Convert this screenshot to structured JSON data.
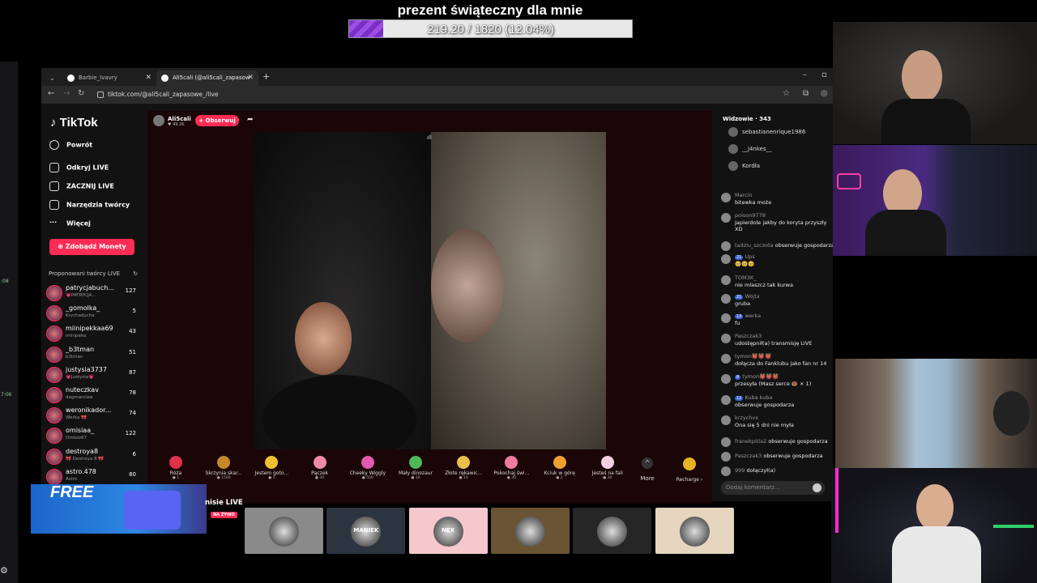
{
  "goal": {
    "title": "prezent świąteczny dla mnie",
    "progress_text": "219.20 / 1820 (12.04%)",
    "progress_percent": 12.04
  },
  "browser": {
    "tabs": [
      {
        "label": "Barbie_Ivavry (@barbie_Ivav"
      },
      {
        "label": "Ali5cali (@ali5cali_zapasow"
      }
    ],
    "url": "tiktok.com/@ali5cali_zapasowe_/live"
  },
  "tiktok": {
    "logo": "TikTok",
    "nav": [
      "Powrót",
      "Odkryj LIVE",
      "ZACZNIJ LIVE",
      "Narzędzia twórcy",
      "Więcej"
    ],
    "coins_button": "Zdobądź Monety",
    "suggested_title": "Proponowani twórcy LIVE",
    "creators": [
      {
        "name": "patrycjabuch...",
        "sub": "💗PATRYCJA...",
        "count": "127"
      },
      {
        "name": "_gomolka_",
        "sub": "Krychadycha",
        "count": "5"
      },
      {
        "name": "miinipekkaa69",
        "sub": "minipeka",
        "count": "43"
      },
      {
        "name": "_b3tman",
        "sub": "b3tman",
        "count": "51"
      },
      {
        "name": "justysia3737",
        "sub": "💗Justysia💗",
        "count": "87"
      },
      {
        "name": "nuteczkav",
        "sub": "dagmarclaw",
        "count": "78"
      },
      {
        "name": "weronikador...",
        "sub": "Werka 🎀",
        "count": "74"
      },
      {
        "name": "omisiaa_",
        "sub": "Omisio67",
        "count": "122"
      },
      {
        "name": "destroya8",
        "sub": "🎀 Destroya 8 🎀",
        "count": "6"
      },
      {
        "name": "astro.478",
        "sub": "Astro",
        "count": "80"
      }
    ]
  },
  "live": {
    "host_name": "Ali5cali",
    "host_likes": "49.2K",
    "follow_label": "+ Obserwuj",
    "gifts": [
      {
        "name": "Róża",
        "price": "1",
        "color": "#e0304a"
      },
      {
        "name": "Skrzynia skar...",
        "price": "1500",
        "color": "#c8882a"
      },
      {
        "name": "Jestem goto...",
        "price": "1",
        "color": "#f0c030"
      },
      {
        "name": "Pączek",
        "price": "30",
        "color": "#f08aa8"
      },
      {
        "name": "Cheeky Wiggly",
        "price": "500",
        "color": "#e05ab0"
      },
      {
        "name": "Mały dinozaur",
        "price": "10",
        "color": "#4cb85a"
      },
      {
        "name": "Złote rękawic...",
        "price": "10",
        "color": "#e8c04a"
      },
      {
        "name": "Pokochaj świ...",
        "price": "30",
        "color": "#f07aa0"
      },
      {
        "name": "Kciuk w górę",
        "price": "2",
        "color": "#f0a030"
      },
      {
        "name": "Jesteś na fali",
        "price": "30",
        "color": "#f4d0e0"
      }
    ],
    "more_label": "More",
    "recharge_label": "Recharge ›"
  },
  "chat": {
    "viewers_title": "Widzowie · 343",
    "viewers": [
      "sebastianenrique1986",
      "__j4nkes__",
      "Kordła"
    ],
    "messages": [
      {
        "user": "Marcin",
        "text": "bitewka może"
      },
      {
        "user": "poison9778",
        "text": "Japierdole jakby do koryta przyszły XD"
      },
      {
        "user": "tadziu_szczota",
        "text": "obserwuje gospodarza"
      },
      {
        "user": "Ups",
        "badge": "21",
        "text": "🥺🥺🥺"
      },
      {
        "user": "TOM3K_",
        "text": "nie mlaszcz tak kurwa"
      },
      {
        "user": "Wojtx",
        "badge": "21",
        "text": "gruba"
      },
      {
        "user": "werka",
        "badge": "13",
        "text": "fu"
      },
      {
        "user": "Paszczak3",
        "text": "udostępnił(a) transmisję LIVE"
      },
      {
        "user": "tymon👹👹👹",
        "text": "dołącza do Fanklubu jako fan nr 14"
      },
      {
        "user": "tymon👹👹👹",
        "badge": "8",
        "text": "przesyła (Masz serce 🍩 × 1)"
      },
      {
        "user": "Kuba kuba",
        "badge": "12",
        "text": "obserwuje gospodarza"
      },
      {
        "user": "krzychvx",
        "text": "Ona się 5 dni nie myła"
      },
      {
        "user": "franekpitla2",
        "text": "obserwuje gospodarza"
      },
      {
        "user": "Paszczak3",
        "text": "obserwuje gospodarza"
      },
      {
        "user": "999",
        "text": "dołączył(a)"
      }
    ],
    "comment_placeholder": "Dodaj komentarz..."
  },
  "bottom": {
    "free_label": "FREE",
    "na_zywo_title": "nisie LIVE",
    "na_zywo_badge": "NA ŻYWO",
    "thumbs": [
      {
        "label": "",
        "bg": "#8a8a8a"
      },
      {
        "label": "MANIEK",
        "bg": "#2c3440"
      },
      {
        "label": "NEX",
        "bg": "#f4c8cc"
      },
      {
        "label": "",
        "bg": "#6a5434"
      },
      {
        "label": "",
        "bg": "#262626"
      },
      {
        "label": "",
        "bg": "#e6d6c0"
      }
    ]
  }
}
